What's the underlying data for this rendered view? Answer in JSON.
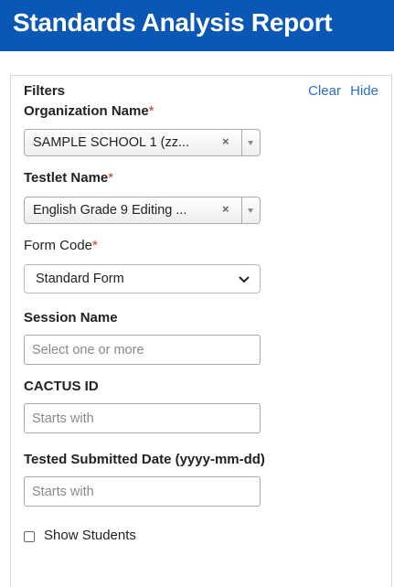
{
  "header": {
    "title": "Standards Analysis Report"
  },
  "filters": {
    "title": "Filters",
    "clear_label": "Clear",
    "hide_label": "Hide",
    "required_marker": "*",
    "organization": {
      "label": "Organization Name",
      "value": "SAMPLE SCHOOL 1 (zz...",
      "clear_glyph": "×"
    },
    "testlet": {
      "label": "Testlet Name",
      "value": "English Grade 9 Editing ...",
      "clear_glyph": "×"
    },
    "form_code": {
      "label": "Form Code",
      "value": "Standard Form"
    },
    "session": {
      "label": "Session Name",
      "placeholder": "Select one or more"
    },
    "cactus": {
      "label": "CACTUS ID",
      "placeholder": "Starts with"
    },
    "tested_date": {
      "label": "Tested Submitted Date (yyyy-mm-dd)",
      "placeholder": "Starts with"
    },
    "show_students": {
      "label": "Show Students",
      "checked": false
    }
  },
  "colors": {
    "header_bg": "#0b57b5",
    "link": "#2a6fc9",
    "required": "#c0392b"
  }
}
